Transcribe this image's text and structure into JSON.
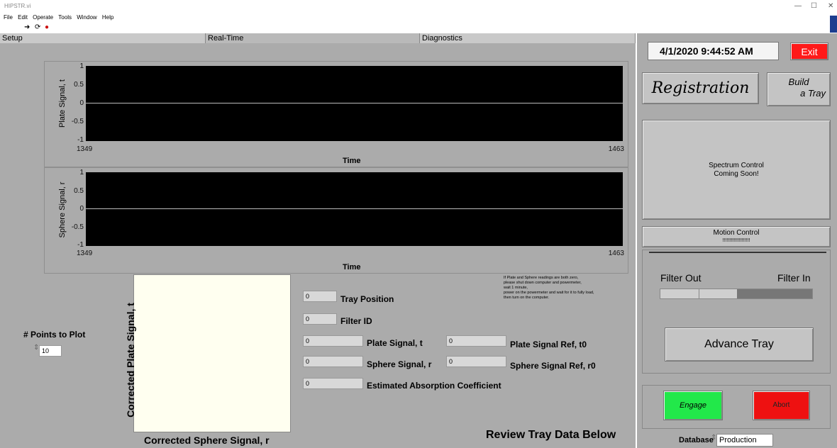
{
  "window": {
    "title": "HIPSTR.vi",
    "minimize": "—",
    "maximize": "☐",
    "close": "✕"
  },
  "menu": [
    "File",
    "Edit",
    "Operate",
    "Tools",
    "Window",
    "Help"
  ],
  "tabs": [
    "Setup",
    "Real-Time",
    "Diagnostics"
  ],
  "chart_top": {
    "type": "line",
    "ylabel": "Plate Signal, t",
    "xlabel": "Time",
    "y_ticks": [
      "1",
      "0.5",
      "0",
      "-0.5",
      "-1"
    ],
    "x_ticks": [
      "1349",
      "1463"
    ],
    "xlim": [
      1349,
      1463
    ],
    "ylim": [
      -1,
      1
    ],
    "values": [
      0,
      0
    ]
  },
  "chart_bottom": {
    "type": "line",
    "ylabel": "Sphere Signal, r",
    "xlabel": "Time",
    "y_ticks": [
      "1",
      "0.5",
      "0",
      "-0.5",
      "-1"
    ],
    "x_ticks": [
      "1349",
      "1463"
    ],
    "xlim": [
      1349,
      1463
    ],
    "ylim": [
      -1,
      1
    ],
    "values": [
      0,
      0
    ]
  },
  "points_to_plot": {
    "label": "# Points to Plot",
    "value": "10"
  },
  "scatter": {
    "ylabel": "Corrected Plate Signal, t",
    "xlabel": "Corrected Sphere Signal, r"
  },
  "fields": {
    "tray_position": {
      "label": "Tray Position",
      "value": "0"
    },
    "filter_id": {
      "label": "Filter ID",
      "value": "0"
    },
    "plate_signal": {
      "label": "Plate Signal, t",
      "value": "0"
    },
    "sphere_signal": {
      "label": "Sphere Signal, r",
      "value": "0"
    },
    "absorption": {
      "label": "Estimated Absorption Coefficient",
      "value": "0"
    },
    "plate_ref": {
      "label": "Plate Signal Ref, t0",
      "value": "0"
    },
    "sphere_ref": {
      "label": "Sphere Signal Ref, r0",
      "value": "0"
    }
  },
  "notice": [
    "If Plate and Sphere readings are both zero,",
    "please shut down computer and powermeter,",
    "wait 1 minute,",
    "power on the powermeter and wait for it to fully load,",
    "then turn on the computer."
  ],
  "review_heading": "Review Tray Data Below",
  "right_panel": {
    "datetime": "4/1/2020 9:44:52 AM",
    "exit_label": "Exit",
    "registration_label": "Registration",
    "build_tray_label": [
      "Build",
      "a Tray"
    ],
    "spectrum_label": [
      "Spectrum Control",
      "Coming Soon!"
    ],
    "motion_label": [
      "Motion Control",
      "!!!!!!!!!!!!!!!!!!!!"
    ],
    "filter_out": "Filter Out",
    "filter_in": "Filter In",
    "filter_state": "in",
    "advance_label": "Advance Tray",
    "engage_label": "Engage",
    "abort_label": "Abort",
    "database_label": "Database",
    "database_value": "Production"
  },
  "colors": {
    "panel": "#ababab",
    "plot_bg": "#000000",
    "exit": "#ff1a1a",
    "engage": "#22e84a",
    "abort": "#ee1111"
  }
}
